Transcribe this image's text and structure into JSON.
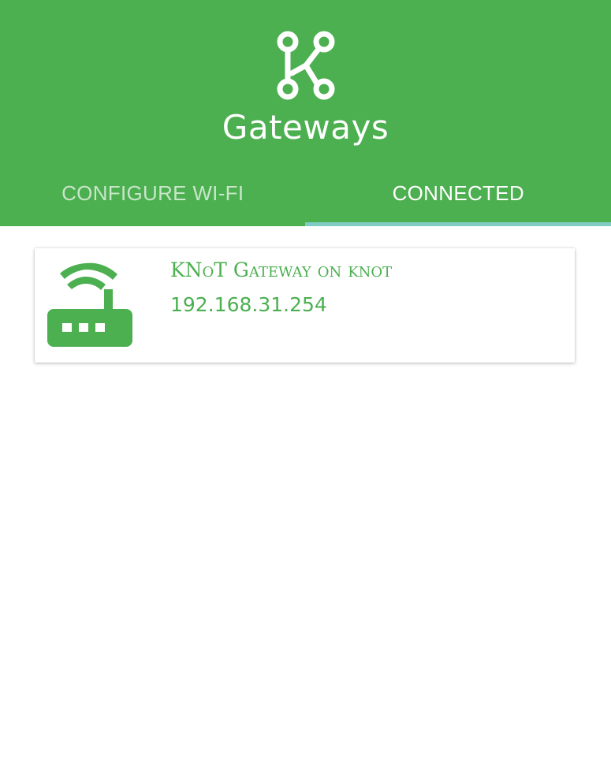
{
  "header": {
    "title": "Gateways",
    "logo_icon": "knot-logo-icon",
    "background_color": "#4caf50"
  },
  "tabs": [
    {
      "label": "CONFIGURE WI-FI",
      "active": false
    },
    {
      "label": "CONNECTED",
      "active": true
    }
  ],
  "indicator_color": "#80cbc4",
  "gateways": [
    {
      "name": "KNoT Gateway on knot",
      "ip": "192.168.31.254",
      "icon": "router-icon"
    }
  ]
}
